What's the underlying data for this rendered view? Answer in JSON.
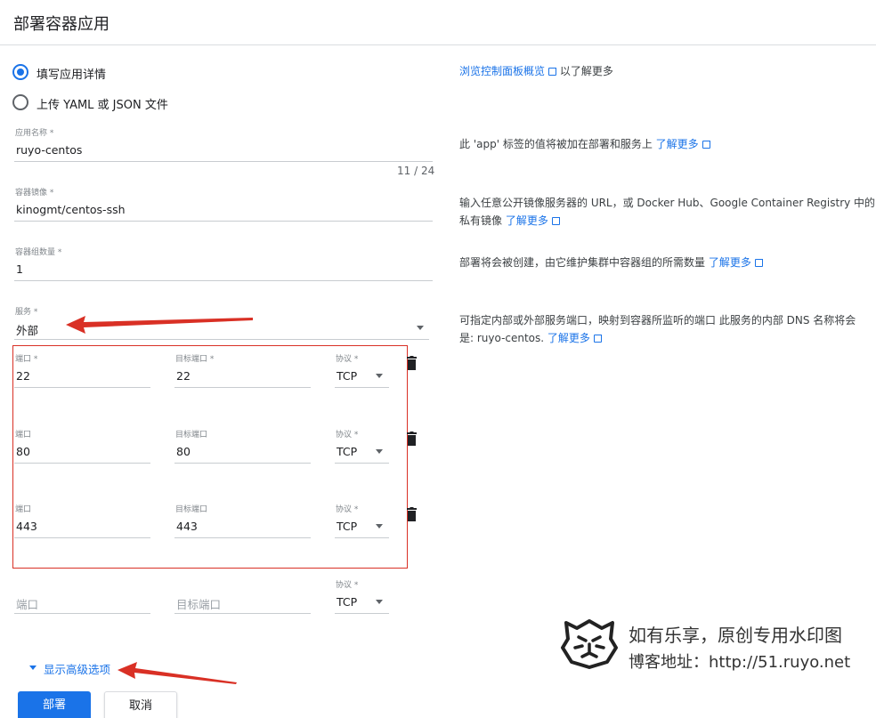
{
  "header": {
    "title": "部署容器应用"
  },
  "source_options": [
    {
      "label": "填写应用详情",
      "checked": true
    },
    {
      "label": "上传 YAML 或 JSON 文件",
      "checked": false
    }
  ],
  "fields": {
    "app_name": {
      "label": "应用名称 *",
      "value": "ruyo-centos",
      "counter": "11 / 24"
    },
    "image": {
      "label": "容器镜像 *",
      "value": "kinogmt/centos-ssh"
    },
    "replicas": {
      "label": "容器组数量 *",
      "value": "1"
    },
    "service": {
      "label": "服务 *",
      "value": "外部"
    }
  },
  "ports": [
    {
      "port_label": "端口 *",
      "port": "22",
      "target_label": "目标端口 *",
      "target": "22",
      "protocol_label": "协议 *",
      "protocol": "TCP"
    },
    {
      "port_label": "端口",
      "port": "80",
      "target_label": "目标端口",
      "target": "80",
      "protocol_label": "协议 *",
      "protocol": "TCP"
    },
    {
      "port_label": "端口",
      "port": "443",
      "target_label": "目标端口",
      "target": "443",
      "protocol_label": "协议 *",
      "protocol": "TCP"
    }
  ],
  "new_port": {
    "port_placeholder": "端口",
    "target_placeholder": "目标端口",
    "protocol_label": "协议 *",
    "protocol": "TCP"
  },
  "help": {
    "dashboard_link": "浏览控制面板概览",
    "dashboard_suffix": "以了解更多",
    "app_label_text": "此 'app' 标签的值将被加在部署和服务上",
    "image_text_1": "输入任意公开镜像服务器的 URL，或 Docker Hub、Google Container Registry 中的",
    "image_text_2": "私有镜像",
    "replicas_text": "部署将会被创建，由它维护集群中容器组的所需数量",
    "service_text_1": "可指定内部或外部服务端口，映射到容器所监听的端口 此服务的内部 DNS 名称将会",
    "service_text_2": "是: ruyo-centos.",
    "learn_more": "了解更多"
  },
  "advanced_toggle": "显示高级选项",
  "buttons": {
    "deploy": "部署",
    "cancel": "取消"
  },
  "watermark": {
    "line1": "如有乐享，原创专用水印图",
    "line2": "博客地址：http://51.ruyo.net"
  },
  "colors": {
    "accent": "#1a73e8",
    "annotation_red": "#d93025"
  }
}
